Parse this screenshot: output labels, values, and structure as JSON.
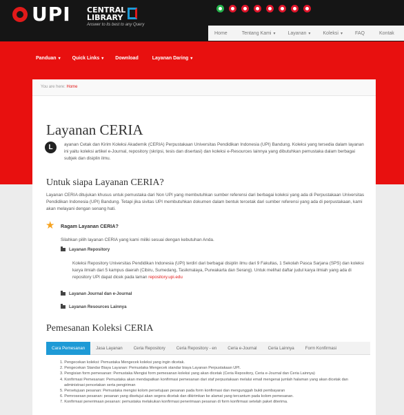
{
  "header": {
    "logo_text": "UPI",
    "library_name": "CENTRAL LIBRARY",
    "tagline": "Answer to its best to any Query",
    "social_icons": [
      "whatsapp-icon",
      "facebook-icon",
      "twitter-icon",
      "instagram-icon",
      "youtube-icon",
      "other-icon",
      "flickr-icon",
      "pinterest-icon"
    ],
    "nav": [
      {
        "label": "Home",
        "caret": ""
      },
      {
        "label": "Tentang Kami",
        "caret": "▾"
      },
      {
        "label": "Layanan",
        "caret": "▾"
      },
      {
        "label": "Koleksi",
        "caret": "▾"
      },
      {
        "label": "FAQ",
        "caret": ""
      },
      {
        "label": "Kontak",
        "caret": ""
      }
    ]
  },
  "subnav": [
    {
      "label": "Panduan",
      "caret": "▾"
    },
    {
      "label": "Quick Links",
      "caret": "▾"
    },
    {
      "label": "Download",
      "caret": ""
    },
    {
      "label": "Layanan Daring",
      "caret": "▾"
    }
  ],
  "breadcrumb": {
    "prefix": "You are here:",
    "current": "Home"
  },
  "page": {
    "title": "Layanan CERIA",
    "dropcap": "L",
    "intro": "ayanan Cetak dan Kirim Koleksi Akademik (CERIA) Perpustakaan Universitas Pendidikan Indonesia (UPI) Bandung. Koleksi yang tersedia dalam layanan ini yaitu koleksi artikel e-Journal, repository (skripsi, tesis dan disertasi) dan koleksi e-Resources lainnya yang dibutuhkan pemustaka dalam berbagai subjek dan disiplin ilmu.",
    "section2_title": "Untuk siapa Layanan CERIA?",
    "section2_text": "Layanan CERIA ditujukan khusus untuk pemustaka dari Non UPI yang membutuhkan sumber referensi dari berbagai koleksi yang ada di Perpustakaan Universitas Pendidikan Indonesia (UPI) Bandung. Tetapi jika sivitas UPI membutuhkan dokumen dalam bentuk tercetak dari sumber referensi yang ada di perpustakaan, kami akan melayani dengan senang hati.",
    "ragam_title": "Ragam Layanan CERIA?",
    "ragam_sub": "Silahkan pilih layanan CERIA yang kami miliki sesuai dengan kebutuhan Anda.",
    "accordion": [
      {
        "label": "Layanan Repository"
      },
      {
        "label": "Layanan Journal dan e-Journal"
      },
      {
        "label": "Layanan Resources Lainnya"
      }
    ],
    "repo_text": "Koleksi Repository Universitas Pendidikan Indonesia (UPI) terdiri dari berbagai disiplin ilmu dari 9 Fakultas, 1 Sekolah Pasca Sarjana (SPS) dan koleksi karya ilmiah dari 5 kampus daerah (Cibiru, Sumedang, Tasikmalaya, Purwakarta dan Serang). Untuk melihat daftar judul karya ilmiah yang ada di repository UPI dapat dicek pada laman",
    "repo_link": "repository.upi.edu",
    "section3_title": "Pemesanan Koleksi CERIA",
    "tabs": [
      "Cara Pemesanan",
      "Jasa Layanan",
      "Ceria Repository",
      "Ceria Repository - en",
      "Ceria e-Journal",
      "Ceria Lainnya",
      "Form Konfirmasi"
    ],
    "steps": [
      "1. Pengecekan koleksi: Pemustaka Mengecek koleksi yang ingin dicetak.",
      "2. Pengecekan Standar Biaya Layanan: Pemustaka Mengecek standar biaya Layanan Perpustakaan UPI.",
      "3. Pengisian form pemesanan: Pemustaka Mengisi form pemesanan koleksi yang akan dicetak (Ceria Repository, Ceria e-Journal dan Ceria Lainnya)",
      "4. Konfirmasi Pemesanan: Pemustaka akan mendapatkan konfirmasi pemesanan dari staf perpustakaan melalui email mengenai jumlah halaman yang akan dicetak dan",
      "administrasi pencetakan serta pengiriman",
      "5. Persetujuan pesanan: Pemustaka mengisi kolom persetujuan pesanan pada form konfirmasi dan mengunggah bukti pembayaran",
      "6. Pemrosesan pesanan: pesanan yang disetujui akan segera dicetak dan dikirimkan ke alamat yang tercantum pada kolom pemesanan.",
      "7. Konfirmasi penerimaan pesanan: pemustaka melakukan konfirmasi penerimaan pesanan di form konfirmasi setelah paket diterima."
    ]
  }
}
